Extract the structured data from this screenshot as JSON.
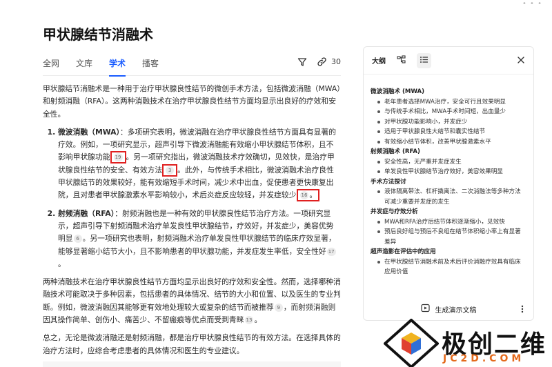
{
  "page": {
    "title": "甲状腺结节消融术"
  },
  "tabs": [
    {
      "label": "全网"
    },
    {
      "label": "文库"
    },
    {
      "label": "学术"
    },
    {
      "label": "播客"
    }
  ],
  "tools": {
    "link_count": "30"
  },
  "article": {
    "intro": "甲状腺结节消融术是一种用于治疗甲状腺良性结节的微创手术方法，包括微波消融（MWA）和射频消融（RFA）。这两种消融技术在治疗甲状腺良性结节方面均显示出良好的疗效和安全性。",
    "item1": {
      "term": "微波消融（MWA）",
      "t1": "：多项研究表明，微波消融在治疗甲状腺良性结节方面具有显著的疗效。例如，一项研究显示，超声引导下微波消融能有效缩小甲状腺结节体积，且不影响甲状腺功能",
      "c1": "19",
      "t2": "。另一项研究指出，微波消融技术疗效确切，见效快，是治疗甲状腺良性结节的安全、有效方法",
      "c2": "3",
      "t3": "。此外，与传统手术相比，微波消融术治疗良性甲状腺结节的效果较好，能有效缩短手术时间，减少术中出血，促使患者更快康复出院，且对患者甲状腺激素水平影响较小，术后炎症反应较轻，并发症较少",
      "c3": "16",
      "t4": "。"
    },
    "item2": {
      "term": "射频消融（RFA）",
      "t1": "：射频消融也是一种有效的甲状腺良性结节治疗方法。一项研究显示，超声引导下射频消融术治疗单发良性甲状腺结节，疗效好，并发症少，美容优势明显",
      "c1": "6",
      "t2": "。另一项研究也表明，射频消融术治疗单发良性甲状腺结节的临床疗效显著，能够显著缩小结节大小，且不影响患者的甲状腺功能，并发症发生率低，安全性好",
      "c2": "17",
      "t3": "。"
    },
    "para2": {
      "t1": "两种消融技术在治疗甲状腺良性结节方面均显示出良好的疗效和安全性。然而，选择哪种消融技术可能取决于多种因素，包括患者的具体情况、结节的大小和位置、以及医生的专业判断。例如，微波消融因其能够更有效地处理较大或复杂的结节而被推荐",
      "c1": "9",
      "t2": "，而射频消融则因其操作简单、创伤小、痛苦少、不留瘢痕等优点而受到青睐",
      "c2": "13",
      "t3": "。"
    },
    "conclusion": "总之，无论是微波消融还是射频消融，都是治疗甲状腺良性结节的有效方法。在选择具体的治疗方法时，应综合考虑患者的具体情况和医生的专业建议。"
  },
  "panel": {
    "tab_outline": "大纲",
    "sections": [
      {
        "title": "微波消融术 (MWA)",
        "items": [
          "老年患者选择MWA治疗，安全可行且效果明显",
          "与传统手术相比，MWA手术时间短，出血量少",
          "对甲状腺功能影响小，并发症少",
          "适用于甲状腺良性大结节和囊实性结节",
          "有效缩小结节体积，改善甲状腺激素水平"
        ]
      },
      {
        "title": "射频消融术 (RFA)",
        "items": [
          "安全性高，无严重并发症发生",
          "单发良性甲状腺结节治疗效好，美容效果明显"
        ]
      },
      {
        "title": "手术方法探讨",
        "items": [
          "液体隔离带法、杠杆撬离法、二次消融法等多种方法可减少重要并发症的发生"
        ]
      },
      {
        "title": "并发症与疗效分析",
        "items": [
          "MWA和RFA治疗后结节体积逐渐缩小，见效快",
          "预后良好组与预后不良组在结节体积缩小率上有显著差异"
        ]
      },
      {
        "title": "超声造影在评估中的应用",
        "items": [
          "在甲状腺结节消融术前及术后评价消融疗效具有临床应用价值"
        ]
      }
    ],
    "footer_label": "生成演示文稿"
  },
  "watermark": {
    "name": "极创二维",
    "url": "JC2D.COM"
  },
  "colors": {
    "accent": "#1a5cff",
    "highlight": "#e02020",
    "brand_orange": "#e46a1c"
  }
}
